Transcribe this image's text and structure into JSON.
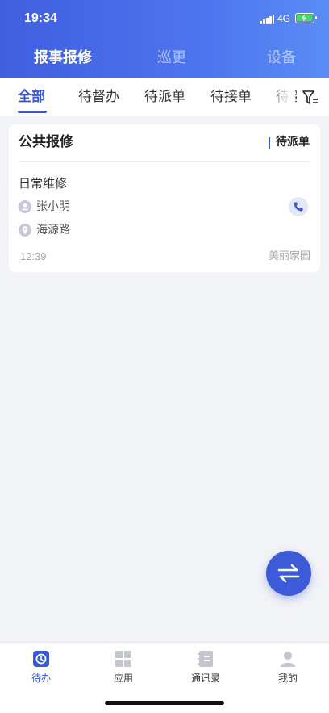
{
  "status_bar": {
    "time": "19:34",
    "network": "4G"
  },
  "top_tabs": [
    "报事报修",
    "巡更",
    "设备"
  ],
  "sub_tabs": [
    "全部",
    "待督办",
    "待派单",
    "待接单",
    "待接"
  ],
  "card": {
    "title": "公共报修",
    "status": "待派单",
    "repair_type": "日常维修",
    "person": "张小明",
    "location": "海源路",
    "time": "12:39",
    "community": "美丽家园"
  },
  "bottom_tabs": [
    "待办",
    "应用",
    "通讯录",
    "我的"
  ],
  "icons": {
    "filter": "filter-icon",
    "person": "person-icon",
    "location": "location-pin-icon",
    "phone": "phone-icon",
    "swap": "swap-arrows-icon",
    "todo": "clock-check-icon",
    "apps": "grid-icon",
    "contacts": "address-book-icon",
    "me": "user-icon"
  },
  "colors": {
    "accent": "#3a57d8",
    "header_start": "#3f5fe0",
    "header_end": "#5a8cf6",
    "background": "#f2f3f7"
  }
}
